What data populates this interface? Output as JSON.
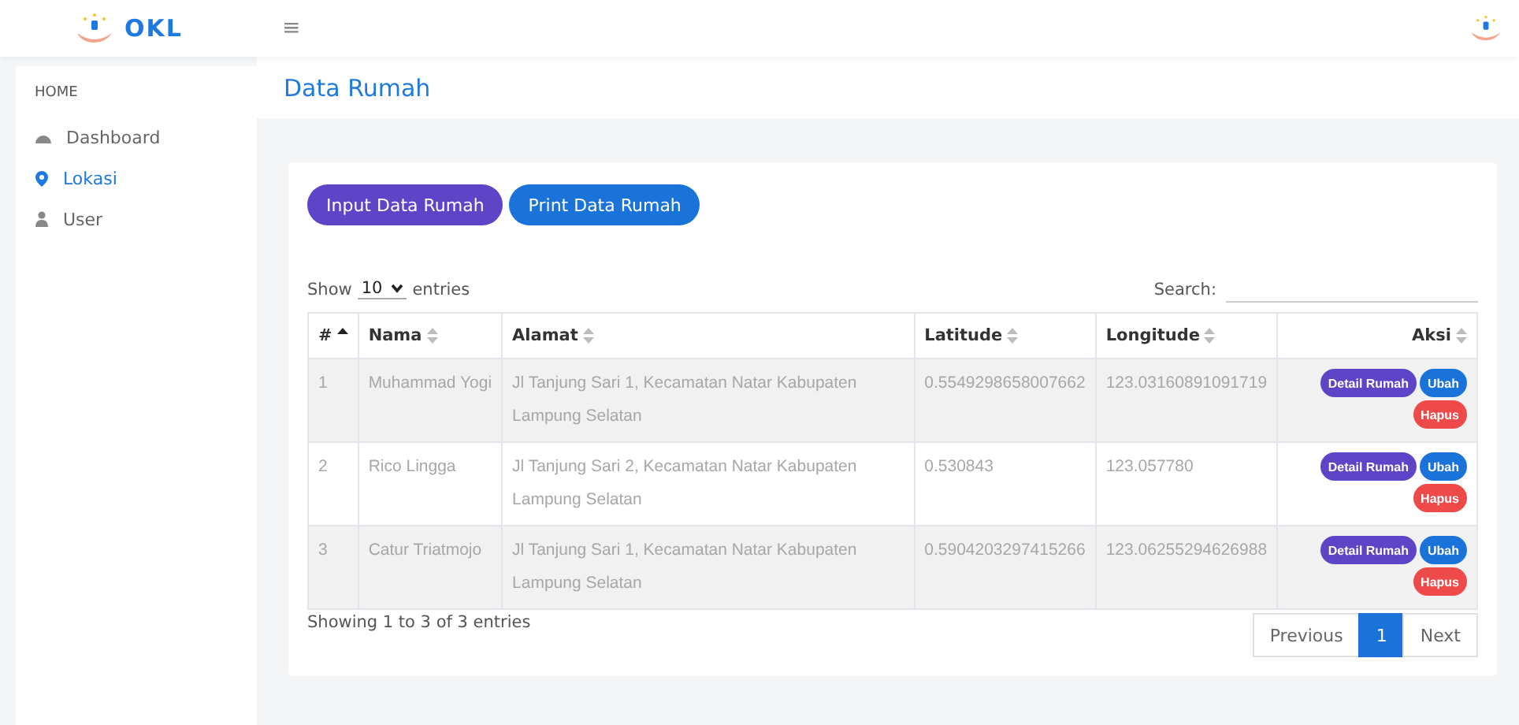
{
  "header": {
    "logo_text": "OKL",
    "menu_icon": "≡"
  },
  "sidebar": {
    "section": "HOME",
    "items": [
      {
        "label": "Dashboard",
        "selected": false
      },
      {
        "label": "Lokasi",
        "selected": true
      },
      {
        "label": "User",
        "selected": false
      }
    ]
  },
  "page_title": "Data Rumah",
  "buttons": [
    {
      "label": "Input Data Rumah",
      "kind": "purple"
    },
    {
      "label": "Print Data Rumah",
      "kind": "blue"
    }
  ],
  "length": {
    "prefix": "Show",
    "value": "10",
    "suffix": "entries"
  },
  "search": {
    "label": "Search:"
  },
  "table": {
    "columns": [
      {
        "label": "#",
        "sorted": true
      },
      {
        "label": "Nama",
        "sorted": false
      },
      {
        "label": "Alamat",
        "sorted": false
      },
      {
        "label": "Latitude",
        "sorted": false
      },
      {
        "label": "Longitude",
        "sorted": false
      },
      {
        "label": "Aksi",
        "sorted": false
      }
    ],
    "rows": [
      {
        "cells": [
          "1",
          "Muhammad Yogi",
          "Jl Tanjung Sari 1, Kecamatan Natar Kabupaten Lampung Selatan",
          "0.5549298658007662",
          "123.03160891091719"
        ],
        "actions": [
          {
            "label": "Detail Rumah",
            "kind": "purple"
          },
          {
            "label": "Ubah",
            "kind": "blue"
          },
          {
            "label": "Hapus",
            "kind": "red"
          }
        ]
      },
      {
        "cells": [
          "2",
          "Rico Lingga",
          "Jl Tanjung Sari 2, Kecamatan Natar Kabupaten Lampung Selatan",
          "0.530843",
          "123.057780"
        ],
        "actions": [
          {
            "label": "Detail Rumah",
            "kind": "purple"
          },
          {
            "label": "Ubah",
            "kind": "blue"
          },
          {
            "label": "Hapus",
            "kind": "red"
          }
        ]
      },
      {
        "cells": [
          "3",
          "Catur Triatmojo",
          "Jl Tanjung Sari 1, Kecamatan Natar Kabupaten Lampung Selatan",
          "0.5904203297415266",
          "123.06255294626988"
        ],
        "actions": [
          {
            "label": "Detail Rumah",
            "kind": "purple"
          },
          {
            "label": "Ubah",
            "kind": "blue"
          },
          {
            "label": "Hapus",
            "kind": "red"
          }
        ]
      }
    ]
  },
  "info": "Showing 1 to 3 of 3 entries",
  "pagination": [
    {
      "label": "Previous",
      "selected": false
    },
    {
      "label": "1",
      "selected": true
    },
    {
      "label": "Next",
      "selected": false
    }
  ]
}
